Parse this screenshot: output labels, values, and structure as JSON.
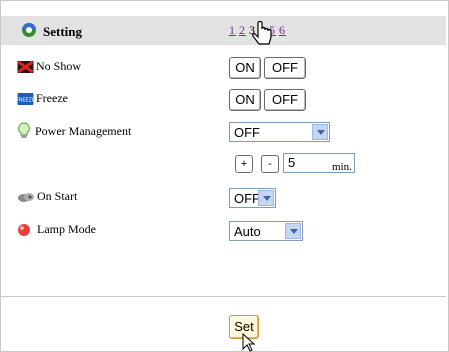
{
  "header": {
    "title": "Setting",
    "icon": "setting-icon",
    "pages": [
      {
        "label": "1",
        "current": false
      },
      {
        "label": "2",
        "current": false
      },
      {
        "label": "3",
        "current": true
      },
      {
        "label": "4",
        "current": false
      },
      {
        "label": "5",
        "current": false
      },
      {
        "label": "6",
        "current": false
      }
    ]
  },
  "no_show": {
    "label": "No Show",
    "icon": "no-show-icon",
    "on_label": "ON",
    "off_label": "OFF"
  },
  "freeze": {
    "label": "Freeze",
    "icon": "freeze-icon",
    "on_label": "ON",
    "off_label": "OFF"
  },
  "power_management": {
    "label": "Power Management",
    "icon": "lightbulb-icon",
    "selected": "OFF",
    "plus_label": "+",
    "minus_label": "-",
    "minutes_value": "5",
    "minutes_unit": "min."
  },
  "on_start": {
    "label": "On Start",
    "icon": "on-start-icon",
    "selected": "OFF"
  },
  "lamp_mode": {
    "label": "Lamp Mode",
    "icon": "lamp-icon",
    "selected": "Auto"
  },
  "set_label": "Set",
  "colors": {
    "header_bg": "#e2e2e2",
    "page_link": "#7a2f9a",
    "select_border": "#7f9db9"
  }
}
